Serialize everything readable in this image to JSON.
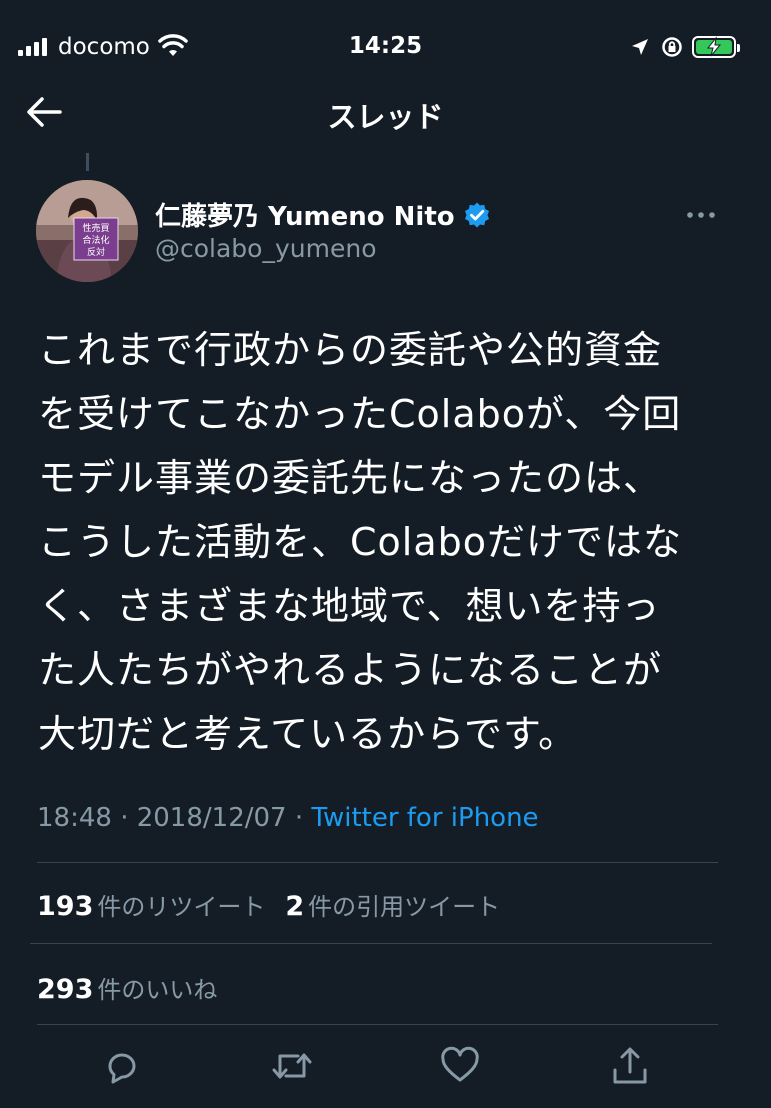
{
  "status_bar": {
    "carrier": "docomo",
    "time": "14:25"
  },
  "nav": {
    "title": "スレッド",
    "icons": [
      "back-arrow-icon"
    ]
  },
  "tweet": {
    "display_name": "仁藤夢乃 Yumeno Nito",
    "handle": "@colabo_yumeno",
    "avatar_sign_text": "性売買合法化反対",
    "lines": [
      "これまで行政からの委託や公的資金",
      "を受けてこなかったColaboが、今回",
      "モデル事業の委託先になったのは、",
      "こうした活動を、Colaboだけではな",
      "く、さまざまな地域で、想いを持っ",
      "た人たちがやれるようになることが",
      "大切だと考えているからです。"
    ],
    "timestamp": "18:48 · 2018/12/07 · ",
    "source": "Twitter for iPhone"
  },
  "stats": {
    "retweets_count": "193",
    "retweets_label": "件のリツイート",
    "quotes_count": "2",
    "quotes_label": "件の引用ツイート",
    "likes_count": "293",
    "likes_label": "件のいいね"
  },
  "actions": [
    "reply-icon",
    "retweet-icon",
    "like-icon",
    "share-icon"
  ],
  "colors": {
    "background": "#141d26",
    "text": "#ffffff",
    "muted": "#8899a6",
    "accent": "#1d9bf0",
    "divider": "#38444d",
    "battery": "#34c759"
  }
}
